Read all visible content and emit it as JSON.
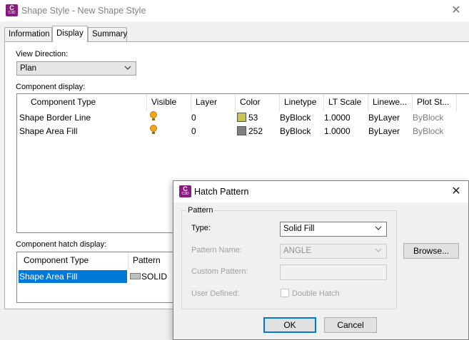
{
  "window": {
    "title": "Shape Style - New Shape Style",
    "icon_label": "C",
    "icon_sub": "C3D",
    "close_glyph": "✕"
  },
  "tabs": [
    {
      "label": "Information",
      "active": false
    },
    {
      "label": "Display",
      "active": true
    },
    {
      "label": "Summary",
      "active": false
    }
  ],
  "view_direction": {
    "label": "View Direction:",
    "value": "Plan"
  },
  "component_display": {
    "label": "Component display:",
    "columns": [
      "Component Type",
      "Visible",
      "Layer",
      "Color",
      "Linetype",
      "LT Scale",
      "Linewe...",
      "Plot St..."
    ],
    "rows": [
      {
        "type": "Shape Border Line",
        "visible_icon": "lightbulb-on-icon",
        "layer": "0",
        "color": "53",
        "color_hex": "#c8c454",
        "linetype": "ByBlock",
        "lt_scale": "1.0000",
        "lineweight": "ByLayer",
        "plot_style": "ByBlock"
      },
      {
        "type": "Shape Area Fill",
        "visible_icon": "lightbulb-on-icon",
        "layer": "0",
        "color": "252",
        "color_hex": "#7f7f7f",
        "linetype": "ByBlock",
        "lt_scale": "1.0000",
        "lineweight": "ByLayer",
        "plot_style": "ByBlock"
      }
    ]
  },
  "component_hatch": {
    "label": "Component hatch display:",
    "columns": [
      "Component Type",
      "Pattern"
    ],
    "rows": [
      {
        "type": "Shape Area Fill",
        "pattern": "SOLID",
        "selected": true
      }
    ]
  },
  "hatch_dialog": {
    "title": "Hatch Pattern",
    "close_glyph": "✕",
    "group_label": "Pattern",
    "type_label": "Type:",
    "type_value": "Solid Fill",
    "pattern_name_label": "Pattern Name:",
    "pattern_name_value": "ANGLE",
    "custom_pattern_label": "Custom Pattern:",
    "custom_pattern_value": "",
    "user_defined_label": "User Defined:",
    "double_hatch_label": "Double Hatch",
    "double_hatch_checked": false,
    "browse_label": "Browse...",
    "ok_label": "OK",
    "cancel_label": "Cancel"
  },
  "colors": {
    "selection": "#0078d7",
    "app_icon": "#8a1a7f",
    "bulb": "#f5a51b"
  }
}
